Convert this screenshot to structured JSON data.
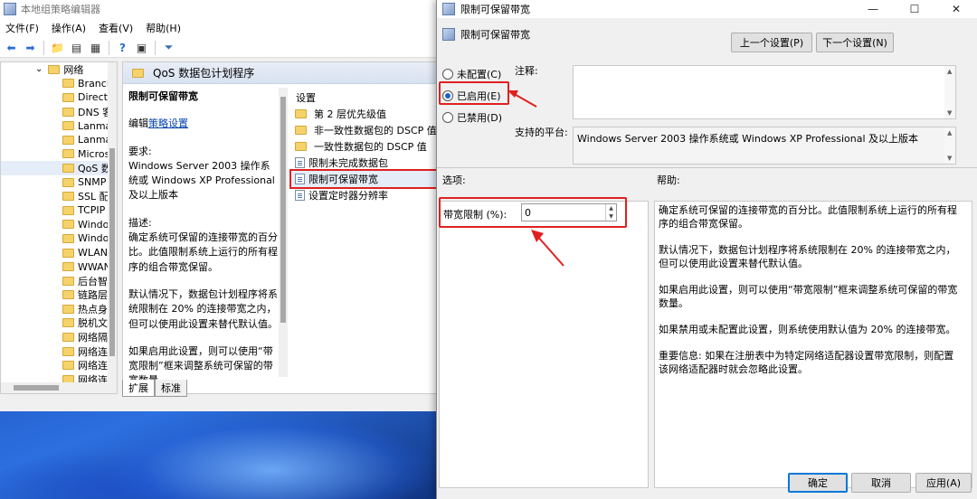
{
  "background_app": {
    "title": "本地组策略编辑器",
    "menu": [
      "文件(F)",
      "操作(A)",
      "查看(V)",
      "帮助(H)"
    ],
    "tree": [
      {
        "label": "网络",
        "expanded": true,
        "level": 0
      },
      {
        "label": "Branch",
        "level": 1
      },
      {
        "label": "Directa",
        "level": 1
      },
      {
        "label": "DNS 客",
        "level": 1
      },
      {
        "label": "Lanma",
        "level": 1
      },
      {
        "label": "Lanma",
        "level": 1
      },
      {
        "label": "Micros",
        "level": 1
      },
      {
        "label": "QoS 数",
        "level": 1,
        "selected": true
      },
      {
        "label": "SNMP",
        "level": 1
      },
      {
        "label": "SSL 配",
        "level": 1
      },
      {
        "label": "TCPIP",
        "level": 1
      },
      {
        "label": "Windo",
        "level": 1
      },
      {
        "label": "Windo",
        "level": 1
      },
      {
        "label": "WLAN",
        "level": 1
      },
      {
        "label": "WWAN",
        "level": 1
      },
      {
        "label": "后台智",
        "level": 1
      },
      {
        "label": "链路层",
        "level": 1
      },
      {
        "label": "热点身",
        "level": 1
      },
      {
        "label": "脱机文",
        "level": 1
      },
      {
        "label": "网络隔",
        "level": 1
      },
      {
        "label": "网络连",
        "level": 1
      },
      {
        "label": "网络连",
        "level": 1
      },
      {
        "label": "网络连",
        "level": 1
      }
    ],
    "pane_header": "QoS 数据包计划程序",
    "desc": {
      "title": "限制可保留带宽",
      "edit_prefix": "编辑",
      "edit_link": "策略设置",
      "req_label": "要求:",
      "req_text": "Windows Server 2003 操作系统或 Windows XP Professional 及以上版本",
      "desc_label": "描述:",
      "desc_text": "确定系统可保留的连接带宽的百分比。此值限制系统上运行的所有程序的组合带宽保留。",
      "default_text": "默认情况下，数据包计划程序将系统限制在 20% 的连接带宽之内，但可以使用此设置来替代默认值。",
      "enable_text": "如果启用此设置，则可以使用“带宽限制”框来调整系统可保留的带宽数量。"
    },
    "settings_header": "设置",
    "settings": [
      {
        "label": "第 2 层优先级值",
        "type": "folder"
      },
      {
        "label": "非一致性数据包的 DSCP 值",
        "type": "folder"
      },
      {
        "label": "一致性数据包的 DSCP 值",
        "type": "folder"
      },
      {
        "label": "限制未完成数据包",
        "type": "setting"
      },
      {
        "label": "限制可保留带宽",
        "type": "setting",
        "selected": true
      },
      {
        "label": "设置定时器分辨率",
        "type": "setting"
      }
    ],
    "tabs": [
      "扩展",
      "标准"
    ]
  },
  "dialog": {
    "title": "限制可保留带宽",
    "header_label": "限制可保留带宽",
    "prev_button": "上一个设置(P)",
    "next_button": "下一个设置(N)",
    "radio_not_configured": "未配置(C)",
    "radio_enabled": "已启用(E)",
    "radio_disabled": "已禁用(D)",
    "comment_label": "注释:",
    "platform_label": "支持的平台:",
    "platform_text": "Windows Server 2003 操作系统或 Windows XP Professional 及以上版本",
    "options_label": "选项:",
    "help_label": "帮助:",
    "bandwidth_label": "带宽限制 (%):",
    "bandwidth_value": "0",
    "help": [
      "确定系统可保留的连接带宽的百分比。此值限制系统上运行的所有程序的组合带宽保留。",
      "默认情况下，数据包计划程序将系统限制在 20% 的连接带宽之内，但可以使用此设置来替代默认值。",
      "如果启用此设置，则可以使用“带宽限制”框来调整系统可保留的带宽数量。",
      "如果禁用或未配置此设置，则系统使用默认值为 20% 的连接带宽。",
      "重要信息: 如果在注册表中为特定网络适配器设置带宽限制，则配置该网络适配器时就会忽略此设置。"
    ],
    "ok_button": "确定",
    "cancel_button": "取消",
    "apply_button": "应用(A)",
    "accent_color": "#e02020"
  }
}
